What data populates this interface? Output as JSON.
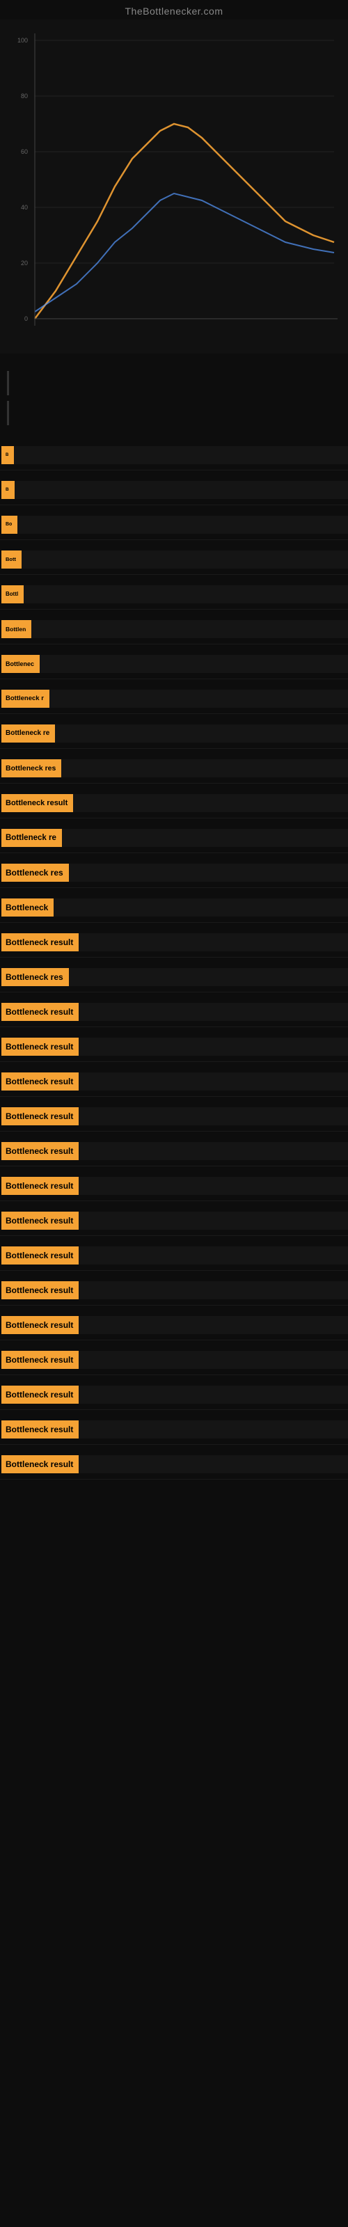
{
  "site": {
    "title": "TheBottlenecker.com"
  },
  "bottleneck_items": [
    {
      "id": 1,
      "label": "B",
      "width_pct": 2
    },
    {
      "id": 2,
      "label": "B",
      "width_pct": 3
    },
    {
      "id": 3,
      "label": "Bo",
      "width_pct": 5
    },
    {
      "id": 4,
      "label": "Bott",
      "width_pct": 8
    },
    {
      "id": 5,
      "label": "Bottl",
      "width_pct": 10
    },
    {
      "id": 6,
      "label": "Bottlen",
      "width_pct": 14
    },
    {
      "id": 7,
      "label": "Bottlenec",
      "width_pct": 18
    },
    {
      "id": 8,
      "label": "Bottleneck r",
      "width_pct": 22
    },
    {
      "id": 9,
      "label": "Bottleneck re",
      "width_pct": 26
    },
    {
      "id": 10,
      "label": "Bottleneck res",
      "width_pct": 30
    },
    {
      "id": 11,
      "label": "Bottleneck result",
      "width_pct": 35
    },
    {
      "id": 12,
      "label": "Bottleneck re",
      "width_pct": 30
    },
    {
      "id": 13,
      "label": "Bottleneck res",
      "width_pct": 32
    },
    {
      "id": 14,
      "label": "Bottleneck",
      "width_pct": 20
    },
    {
      "id": 15,
      "label": "Bottleneck result",
      "width_pct": 35
    },
    {
      "id": 16,
      "label": "Bottleneck res",
      "width_pct": 32
    },
    {
      "id": 17,
      "label": "Bottleneck result",
      "width_pct": 38
    },
    {
      "id": 18,
      "label": "Bottleneck result",
      "width_pct": 38
    },
    {
      "id": 19,
      "label": "Bottleneck result",
      "width_pct": 38
    },
    {
      "id": 20,
      "label": "Bottleneck result",
      "width_pct": 40
    },
    {
      "id": 21,
      "label": "Bottleneck result",
      "width_pct": 40
    },
    {
      "id": 22,
      "label": "Bottleneck result",
      "width_pct": 40
    },
    {
      "id": 23,
      "label": "Bottleneck result",
      "width_pct": 40
    },
    {
      "id": 24,
      "label": "Bottleneck result",
      "width_pct": 40
    },
    {
      "id": 25,
      "label": "Bottleneck result",
      "width_pct": 40
    },
    {
      "id": 26,
      "label": "Bottleneck result",
      "width_pct": 40
    },
    {
      "id": 27,
      "label": "Bottleneck result",
      "width_pct": 40
    },
    {
      "id": 28,
      "label": "Bottleneck result",
      "width_pct": 40
    },
    {
      "id": 29,
      "label": "Bottleneck result",
      "width_pct": 40
    },
    {
      "id": 30,
      "label": "Bottleneck result",
      "width_pct": 40
    }
  ],
  "chart": {
    "title": "",
    "y_labels": [
      "100",
      "80",
      "60",
      "40",
      "20",
      "0"
    ]
  },
  "colors": {
    "accent": "#f5a234",
    "background": "#0d0d0d",
    "text_primary": "#ffffff",
    "text_secondary": "#888888"
  }
}
